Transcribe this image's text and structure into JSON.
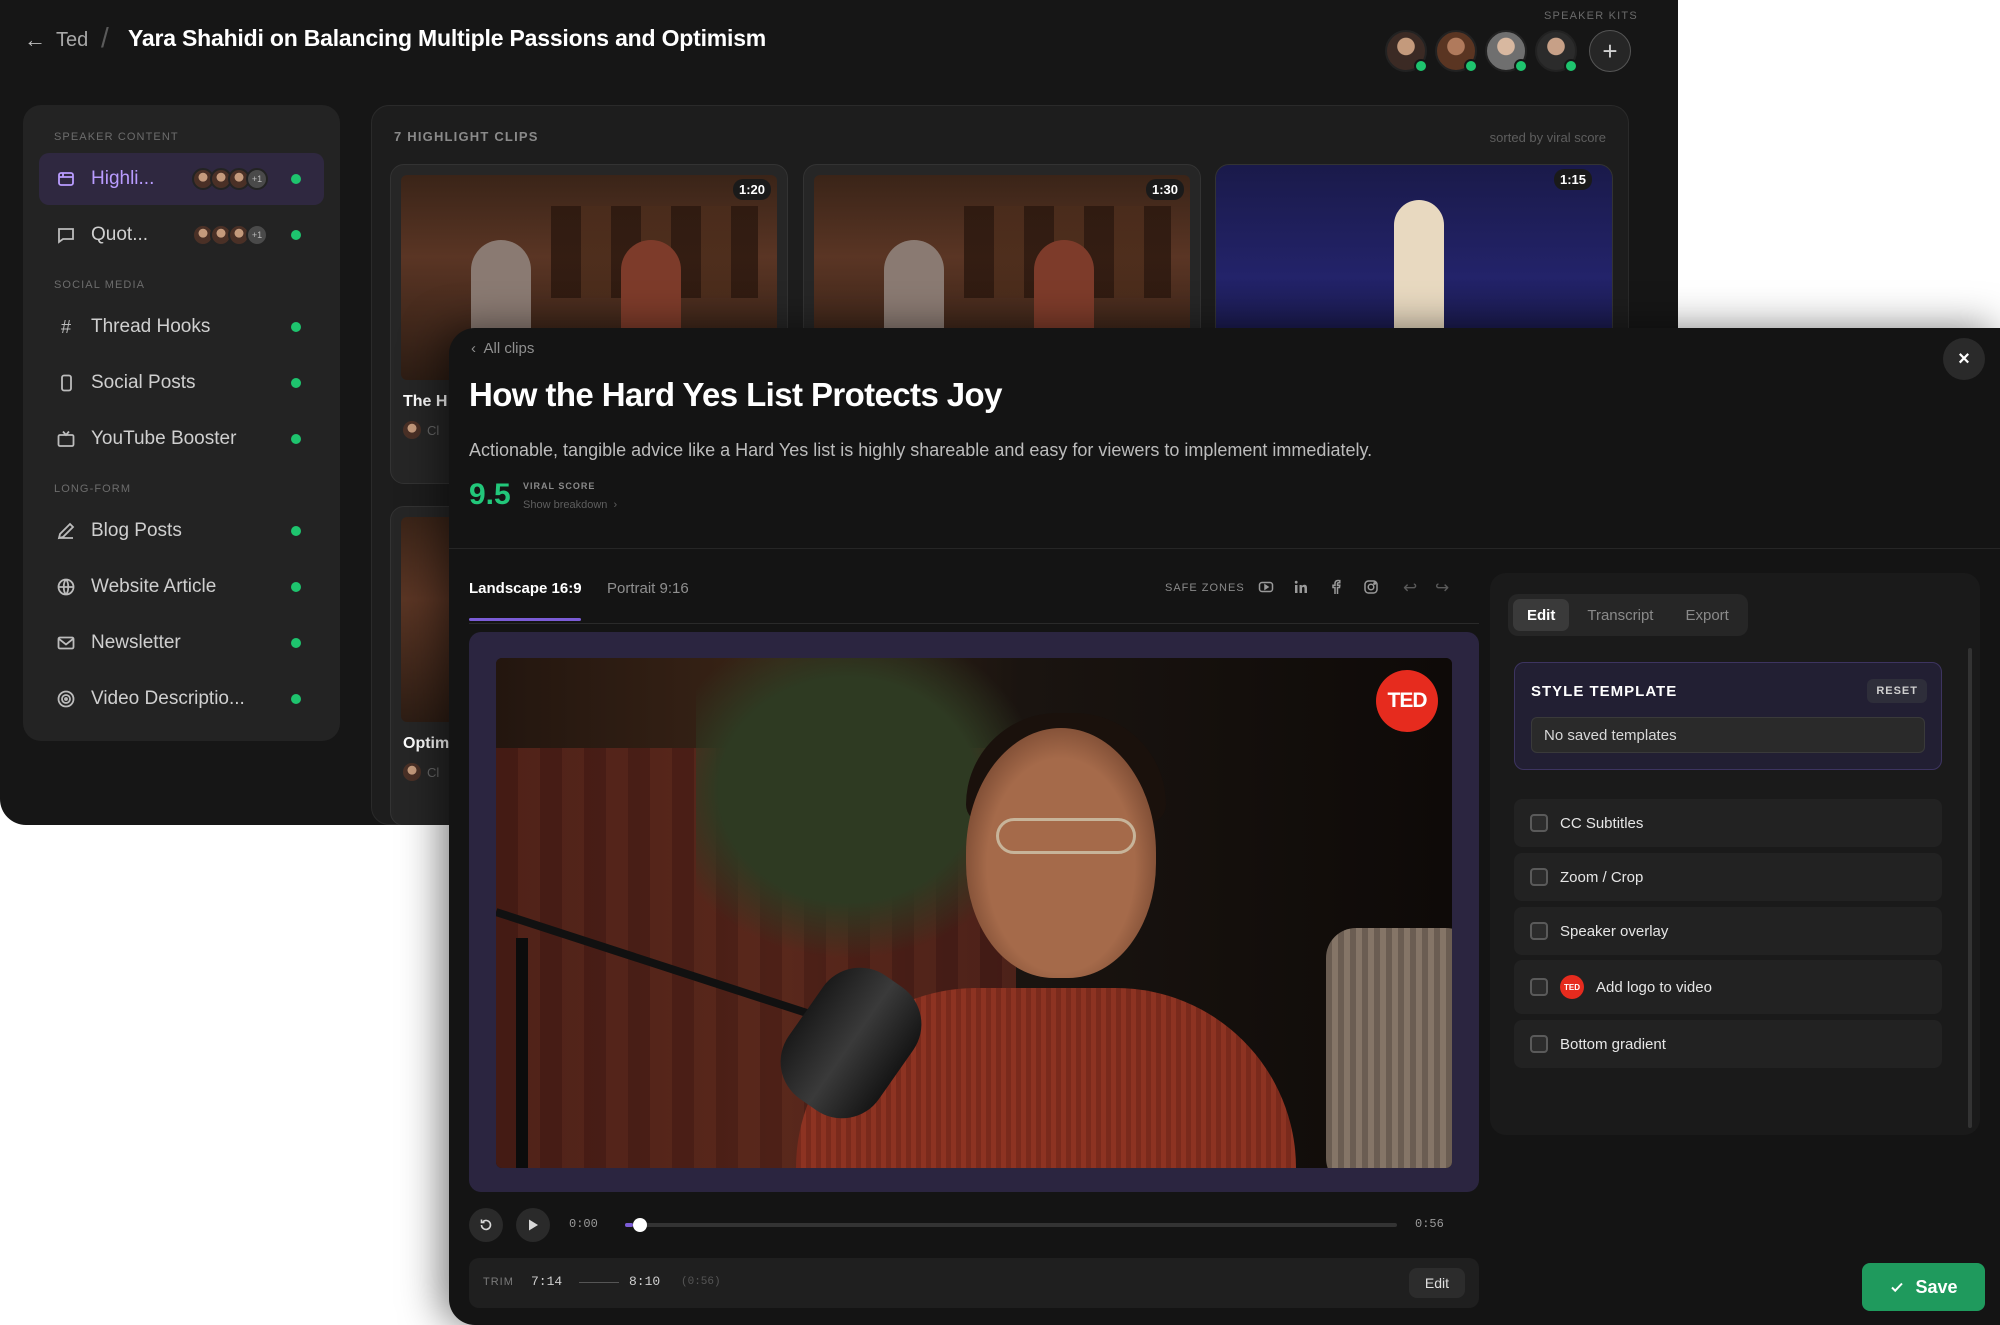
{
  "header": {
    "back_label": "Ted",
    "title": "Yara Shahidi on Balancing Multiple Passions and Optimism",
    "kits_label": "SPEAKER KITS",
    "add_kit_label": "+"
  },
  "sidebar": {
    "sections": [
      {
        "label": "SPEAKER CONTENT"
      },
      {
        "label": "SOCIAL MEDIA"
      },
      {
        "label": "LONG-FORM"
      }
    ],
    "items": [
      {
        "label": "Highli...",
        "icon": "highlight-icon",
        "more": "+1"
      },
      {
        "label": "Quot...",
        "icon": "quote-icon",
        "more": "+1"
      },
      {
        "label": "Thread Hooks",
        "icon": "hash-icon"
      },
      {
        "label": "Social Posts",
        "icon": "phone-icon"
      },
      {
        "label": "YouTube Booster",
        "icon": "tv-icon"
      },
      {
        "label": "Blog Posts",
        "icon": "pen-icon"
      },
      {
        "label": "Website Article",
        "icon": "globe-icon"
      },
      {
        "label": "Newsletter",
        "icon": "mail-icon"
      },
      {
        "label": "Video Descriptio...",
        "icon": "target-icon"
      }
    ]
  },
  "clips": {
    "count_label": "7 HIGHLIGHT CLIPS",
    "sort_label": "sorted by viral score",
    "cards": [
      {
        "duration": "1:20",
        "title": "The H",
        "sub": "Cl"
      },
      {
        "duration": "1:30"
      },
      {
        "duration": "1:15"
      },
      {
        "title": "Optim",
        "sub": "Cl"
      }
    ]
  },
  "modal": {
    "back_label": "All clips",
    "title": "How the Hard Yes List Protects Joy",
    "description": "Actionable, tangible advice like a Hard Yes list is highly shareable and easy for viewers to implement immediately.",
    "score": "9.5",
    "score_label": "VIRAL SCORE",
    "breakdown_label": "Show breakdown",
    "close_label": "×",
    "tabs": {
      "landscape": "Landscape 16:9",
      "portrait": "Portrait 9:16"
    },
    "safe_zones_label": "SAFE ZONES",
    "video": {
      "logo_text": "TED"
    },
    "player": {
      "current_time": "0:00",
      "total_time": "0:56",
      "progress": 0.01
    },
    "trim": {
      "label": "TRIM",
      "start": "7:14",
      "end": "8:10",
      "duration": "(0:56)",
      "edit_label": "Edit"
    },
    "panel": {
      "tabs": {
        "edit": "Edit",
        "transcript": "Transcript",
        "export": "Export"
      },
      "style_title": "STYLE TEMPLATE",
      "reset_label": "RESET",
      "template_value": "No saved templates",
      "options": [
        {
          "label": "CC Subtitles"
        },
        {
          "label": "Zoom / Crop"
        },
        {
          "label": "Speaker overlay"
        },
        {
          "label": "Add logo to video",
          "logo": "TED"
        },
        {
          "label": "Bottom gradient"
        }
      ]
    },
    "save_label": "Save"
  }
}
